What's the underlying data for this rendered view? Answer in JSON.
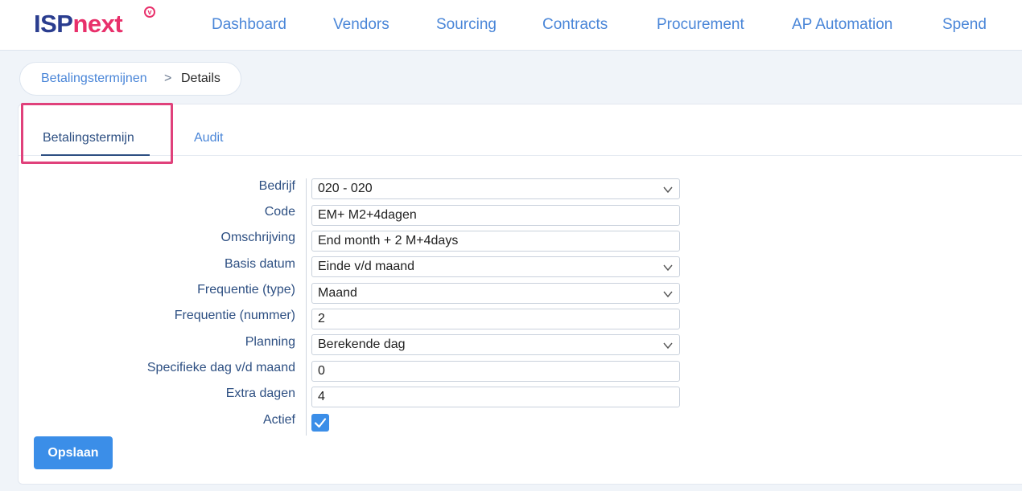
{
  "logo": {
    "part1": "ISP",
    "part2": "next",
    "badge": "v"
  },
  "nav": [
    {
      "label": "Dashboard"
    },
    {
      "label": "Vendors"
    },
    {
      "label": "Sourcing"
    },
    {
      "label": "Contracts"
    },
    {
      "label": "Procurement"
    },
    {
      "label": "AP Automation"
    },
    {
      "label": "Spend"
    }
  ],
  "breadcrumb": {
    "parent": "Betalingstermijnen",
    "separator": ">",
    "current": "Details"
  },
  "tabs": [
    {
      "label": "Betalingstermijn",
      "active": true
    },
    {
      "label": "Audit",
      "active": false
    }
  ],
  "form": {
    "fields": [
      {
        "label": "Bedrijf",
        "value": "020 - 020",
        "type": "select"
      },
      {
        "label": "Code",
        "value": "EM+ M2+4dagen",
        "type": "text"
      },
      {
        "label": "Omschrijving",
        "value": "End month + 2 M+4days",
        "type": "text"
      },
      {
        "label": "Basis datum",
        "value": "Einde v/d maand",
        "type": "select"
      },
      {
        "label": "Frequentie (type)",
        "value": "Maand",
        "type": "select"
      },
      {
        "label": "Frequentie (nummer)",
        "value": "2",
        "type": "text"
      },
      {
        "label": "Planning",
        "value": "Berekende dag",
        "type": "select"
      },
      {
        "label": "Specifieke dag v/d maand",
        "value": "0",
        "type": "text"
      },
      {
        "label": "Extra dagen",
        "value": "4",
        "type": "text"
      }
    ],
    "actief": {
      "label": "Actief",
      "checked": true
    },
    "save_label": "Opslaan"
  },
  "colors": {
    "accent": "#3b8ee8",
    "nav_link": "#4a86d8",
    "label": "#2d4f82",
    "brand_blue": "#2a3d8f",
    "brand_pink": "#e8306b",
    "highlight": "#e0417b"
  },
  "icons": {
    "select": "chevron-down-icon",
    "checkbox": "checkmark-icon",
    "logo_badge": "heart-badge-icon"
  }
}
